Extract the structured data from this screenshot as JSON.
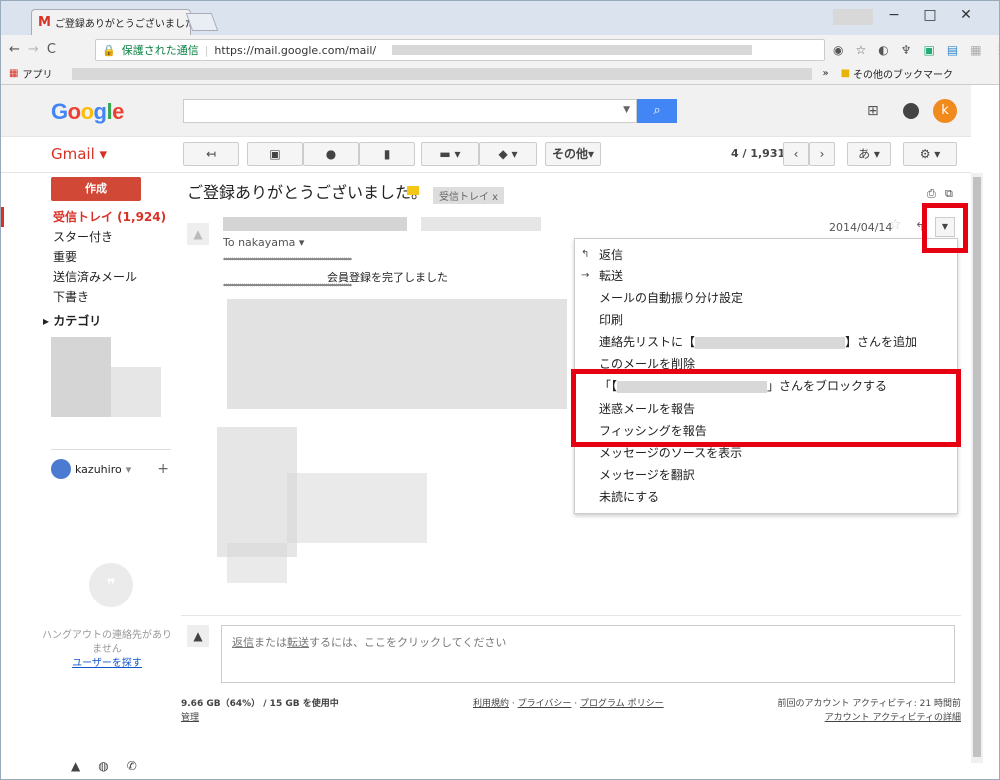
{
  "browser": {
    "tab_title": "ご登録ありがとうございました",
    "tab_close": "×",
    "window_controls": [
      "−",
      "□",
      "✕"
    ],
    "secure_label": "保護された通信",
    "url": "https://mail.google.com/mail/",
    "apps_label": "アプリ",
    "other_bookmarks": "その他のブックマーク",
    "bookmark_overflow": "»"
  },
  "header": {
    "logo": "Google",
    "avatar_letter": "k"
  },
  "toolbar": {
    "gmail_label": "Gmail ▾",
    "more_label": "その他▾",
    "count": "4 / 1,931",
    "input_tool": "あ"
  },
  "sidebar": {
    "compose": "作成",
    "items": [
      {
        "label": "受信トレイ (1,924)"
      },
      {
        "label": "スター付き"
      },
      {
        "label": "重要"
      },
      {
        "label": "送信済みメール"
      },
      {
        "label": "下書き"
      },
      {
        "label": "カテゴリ"
      }
    ],
    "user": "kazuhiro",
    "hangouts_msg": "ハングアウトの連絡先がありません",
    "find_people": "ユーザーを探す"
  },
  "message": {
    "subject": "ご登録ありがとうございました。",
    "label": "受信トレイ x",
    "date": "2014/04/14",
    "to": "To nakayama",
    "stars_line": "****************************************************************",
    "reg_done": "会員登録を完了しました"
  },
  "menu": {
    "items": [
      {
        "icon": "↰",
        "label": "返信"
      },
      {
        "icon": "→",
        "label": "転送"
      },
      {
        "icon": "",
        "label": "メールの自動振り分け設定"
      },
      {
        "icon": "",
        "label": "印刷"
      },
      {
        "icon": "",
        "label_pre": "連絡先リストに【",
        "label_post": "】さんを追加"
      },
      {
        "icon": "",
        "label": "このメールを削除"
      },
      {
        "icon": "",
        "label_pre": "「【",
        "label_post": "」さんをブロックする"
      },
      {
        "icon": "",
        "label": "迷惑メールを報告"
      },
      {
        "icon": "",
        "label": "フィッシングを報告"
      },
      {
        "icon": "",
        "label": "メッセージのソースを表示"
      },
      {
        "icon": "",
        "label": "メッセージを翻訳"
      },
      {
        "icon": "",
        "label": "未読にする"
      }
    ]
  },
  "reply": {
    "text_pre": "",
    "reply_link": "返信",
    "text_mid": "または",
    "forward_link": "転送",
    "text_post": "するには、ここをクリックしてください"
  },
  "footer": {
    "storage": "9.66 GB（64%） / 15 GB を使用中",
    "manage": "管理",
    "terms": "利用規約",
    "privacy": "プライバシー",
    "program_policy": "プログラム ポリシー",
    "last_activity": "前回のアカウント アクティビティ: 21 時間前",
    "activity_details": "アカウント アクティビティの詳細"
  }
}
